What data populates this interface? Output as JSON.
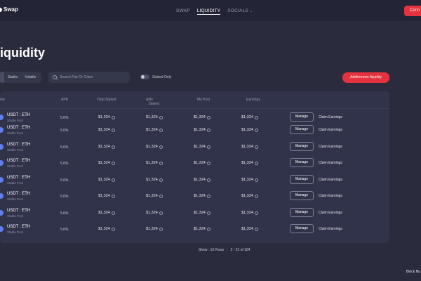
{
  "header": {
    "brand": "Swap",
    "nav": [
      {
        "label": "SWAP"
      },
      {
        "label": "LIQUIDITY"
      },
      {
        "label": "SOCIALS"
      }
    ],
    "connect_label": "Conn"
  },
  "page_title": "iquidity",
  "toolbar": {
    "tabs": [
      "Stable",
      "Volatile"
    ],
    "search_placeholder": "Search Pair Or Token",
    "toggle_label": "Staked Only",
    "add_button": "Add/remove liquidity"
  },
  "table": {
    "columns": [
      "me",
      "APR",
      "Total Staked",
      "My Staked",
      "My Pool",
      "Earnings"
    ],
    "rows": [
      {
        "pair": "USDT : ETH",
        "sub": "Stable Pool",
        "apr": "5.6%",
        "total": "$1,324",
        "staked": "$1,324",
        "pool": "$1,324",
        "earn": "$1,324",
        "manage": "Manage",
        "claim": "Claim Earnings"
      },
      {
        "pair": "USDT : ETH",
        "sub": "Stable Pool",
        "apr": "5.6%",
        "total": "$1,324",
        "staked": "$1,324",
        "pool": "$1,324",
        "earn": "$1,324",
        "manage": "Manage",
        "claim": "Claim Earnings"
      },
      {
        "pair": "USDT : ETH",
        "sub": "Stable Pool",
        "apr": "5.6%",
        "total": "$1,324",
        "staked": "$1,324",
        "pool": "$1,324",
        "earn": "$1,324",
        "manage": "Manage",
        "claim": "Claim Earnings"
      },
      {
        "pair": "USDT : ETH",
        "sub": "Stable Pool",
        "apr": "5.6%",
        "total": "$1,324",
        "staked": "$1,324",
        "pool": "$1,324",
        "earn": "$1,324",
        "manage": "Manage",
        "claim": "Claim Earnings"
      },
      {
        "pair": "USDT : ETH",
        "sub": "Stable Pool",
        "apr": "5.6%",
        "total": "$1,324",
        "staked": "$1,324",
        "pool": "$1,324",
        "earn": "$1,324",
        "manage": "Manage",
        "claim": "Claim Earnings"
      },
      {
        "pair": "USDT : ETH",
        "sub": "Stable Pool",
        "apr": "5.6%",
        "total": "$1,324",
        "staked": "$1,324",
        "pool": "$1,324",
        "earn": "$1,324",
        "manage": "Manage",
        "claim": "Claim Earnings"
      },
      {
        "pair": "USDT : ETH",
        "sub": "Stable Pool",
        "apr": "5.6%",
        "total": "$1,324",
        "staked": "$1,324",
        "pool": "$1,324",
        "earn": "$1,324",
        "manage": "Manage",
        "claim": "Claim Earnings"
      },
      {
        "pair": "USDT : ETH",
        "sub": "Stable Pool",
        "apr": "5.6%",
        "total": "$1,324",
        "staked": "$1,324",
        "pool": "$1,324",
        "earn": "$1,324",
        "manage": "Manage",
        "claim": "Claim Earnings"
      }
    ]
  },
  "pager": {
    "show": "Show : 10 Rows",
    "range": "2 - 31 of 184"
  },
  "footer": "Block Nu",
  "colors": {
    "accent": "#e5323f",
    "bg": "#2a2c3e",
    "panel": "#31334a"
  }
}
